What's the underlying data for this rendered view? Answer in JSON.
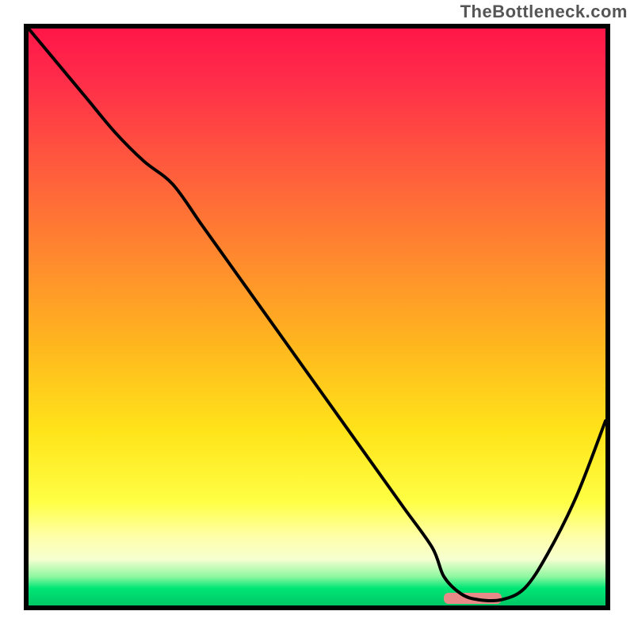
{
  "watermark": "TheBottleneck.com",
  "colors": {
    "frame": "#000000",
    "curve": "#000000",
    "marker": "#e88b88",
    "gradient_top": "#ff1648",
    "gradient_bottom": "#00c764"
  },
  "chart_data": {
    "type": "line",
    "title": "",
    "xlabel": "",
    "ylabel": "",
    "xlim": [
      0,
      100
    ],
    "ylim": [
      0,
      100
    ],
    "grid": false,
    "legend": false,
    "series": [
      {
        "name": "bottleneck-curve",
        "x": [
          0,
          5,
          10,
          15,
          20,
          25,
          30,
          35,
          40,
          45,
          50,
          55,
          60,
          65,
          70,
          72,
          75,
          78,
          82,
          86,
          90,
          95,
          100
        ],
        "y": [
          100,
          94,
          88,
          82,
          77,
          73,
          66,
          59,
          52,
          45,
          38,
          31,
          24,
          17,
          10,
          5,
          2,
          1,
          1,
          3,
          9,
          19,
          32
        ]
      }
    ],
    "annotations": [
      {
        "name": "optimal-range-marker",
        "kind": "rect",
        "x0": 72,
        "x1": 82,
        "y": 0,
        "color": "#e88b88"
      }
    ]
  }
}
